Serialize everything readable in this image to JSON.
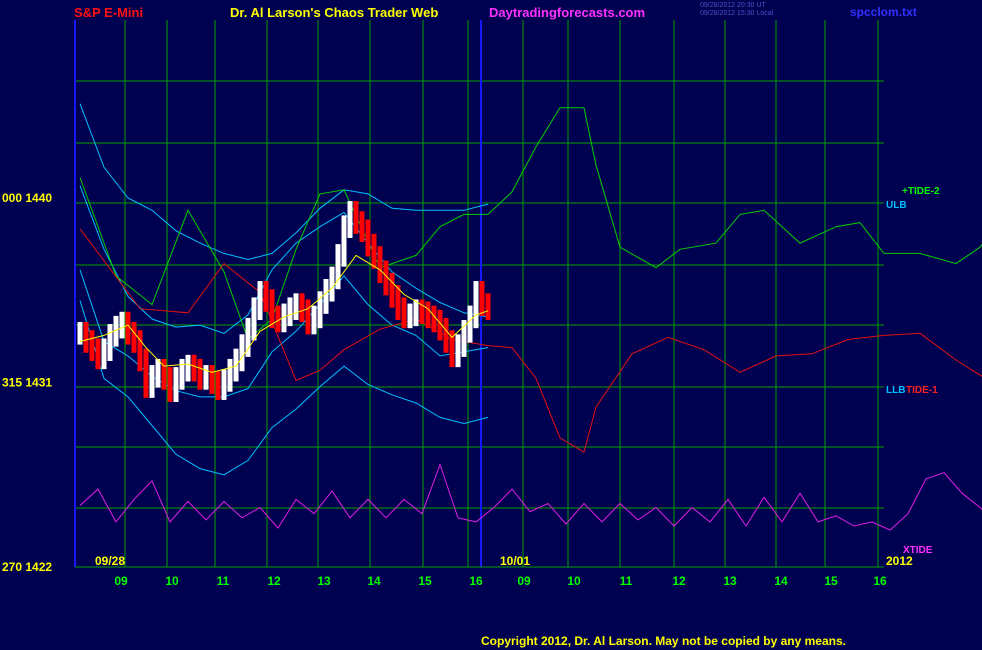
{
  "header": {
    "symbol": "S&P E-Mini",
    "title": "Dr. Al Larson's Chaos Trader Web",
    "site": "Daytradingforecasts.com",
    "stamp_line1": "09/28/2012 20:30 UT",
    "stamp_line2": "09/28/2012 15:30 Local",
    "file": "spcclom.txt"
  },
  "footer": {
    "copyright": "Copyright 2012, Dr. Al Larson. May not be copied by any means."
  },
  "colors": {
    "background": "#000050",
    "grid": "#00a000",
    "price_up": "#ffffff",
    "price_down": "#ff0000",
    "average": "#ffff00",
    "band": "#00c0ff",
    "tide_plus2": "#00d000",
    "tide_minus1": "#e01010",
    "xtide": "#e020e0",
    "divider": "#1818ff"
  },
  "chart_data": {
    "type": "line",
    "left_axis_labels": [
      {
        "text": "000  1440",
        "price": 1440
      },
      {
        "text": "315  1431",
        "price": 1431
      },
      {
        "text": "270  1422",
        "price": 1422
      }
    ],
    "ylim": [
      1422,
      1440
    ],
    "date_labels": [
      "09/28",
      "10/01"
    ],
    "hour_ticks": [
      "09",
      "10",
      "11",
      "12",
      "13",
      "14",
      "15",
      "16",
      "09",
      "10",
      "11",
      "12",
      "13",
      "14",
      "15",
      "16"
    ],
    "year_label": "2012",
    "series_labels": [
      "+TIDE-2",
      "ULB",
      "LLB",
      "TIDE-1",
      "XTIDE"
    ],
    "price_bars": [
      [
        0,
        1433.4
      ],
      [
        1,
        1433.0
      ],
      [
        2,
        1432.6
      ],
      [
        3,
        1432.2
      ],
      [
        4,
        1432.6
      ],
      [
        5,
        1433.3
      ],
      [
        6,
        1433.7
      ],
      [
        7,
        1433.9
      ],
      [
        8,
        1433.4
      ],
      [
        9,
        1433.0
      ],
      [
        10,
        1432.1
      ],
      [
        11,
        1430.8
      ],
      [
        12,
        1431.3
      ],
      [
        13,
        1431.6
      ],
      [
        14,
        1431.2
      ],
      [
        15,
        1430.6
      ],
      [
        16,
        1431.2
      ],
      [
        17,
        1431.6
      ],
      [
        18,
        1431.8
      ],
      [
        19,
        1431.6
      ],
      [
        20,
        1431.2
      ],
      [
        21,
        1431.3
      ],
      [
        22,
        1431.0
      ],
      [
        23,
        1430.7
      ],
      [
        24,
        1431.1
      ],
      [
        25,
        1431.6
      ],
      [
        26,
        1432.1
      ],
      [
        27,
        1432.8
      ],
      [
        28,
        1433.6
      ],
      [
        29,
        1434.6
      ],
      [
        30,
        1435.4
      ],
      [
        31,
        1435.0
      ],
      [
        32,
        1434.2
      ],
      [
        33,
        1434.0
      ],
      [
        34,
        1434.3
      ],
      [
        35,
        1434.6
      ],
      [
        36,
        1434.8
      ],
      [
        37,
        1434.5
      ],
      [
        38,
        1433.9
      ],
      [
        39,
        1434.2
      ],
      [
        40,
        1434.9
      ],
      [
        41,
        1435.5
      ],
      [
        42,
        1436.1
      ],
      [
        43,
        1437.2
      ],
      [
        44,
        1438.6
      ],
      [
        45,
        1439.3
      ],
      [
        46,
        1438.8
      ],
      [
        47,
        1438.4
      ],
      [
        48,
        1437.7
      ],
      [
        49,
        1437.1
      ],
      [
        50,
        1436.4
      ],
      [
        51,
        1435.8
      ],
      [
        52,
        1435.2
      ],
      [
        53,
        1434.6
      ],
      [
        54,
        1434.2
      ],
      [
        55,
        1434.3
      ],
      [
        56,
        1434.5
      ],
      [
        57,
        1434.4
      ],
      [
        58,
        1434.2
      ],
      [
        59,
        1434.0
      ],
      [
        60,
        1433.6
      ],
      [
        61,
        1433.0
      ],
      [
        62,
        1432.3
      ],
      [
        63,
        1432.8
      ],
      [
        64,
        1433.5
      ],
      [
        65,
        1434.2
      ],
      [
        66,
        1435.4
      ],
      [
        67,
        1434.8
      ],
      [
        68,
        1434.6
      ]
    ],
    "price_x": {
      "start": 0,
      "end": 68
    },
    "average": [
      [
        0,
        1433.0
      ],
      [
        4,
        1433.3
      ],
      [
        8,
        1433.8
      ],
      [
        11,
        1432.7
      ],
      [
        14,
        1431.8
      ],
      [
        18,
        1431.9
      ],
      [
        22,
        1431.5
      ],
      [
        26,
        1431.8
      ],
      [
        30,
        1433.5
      ],
      [
        34,
        1434.2
      ],
      [
        38,
        1434.6
      ],
      [
        42,
        1435.6
      ],
      [
        46,
        1437.2
      ],
      [
        50,
        1436.5
      ],
      [
        54,
        1435.3
      ],
      [
        58,
        1434.6
      ],
      [
        62,
        1433.2
      ],
      [
        66,
        1434.3
      ],
      [
        68,
        1434.5
      ]
    ],
    "upper_band_1": [
      [
        0,
        1444.6
      ],
      [
        4,
        1441.5
      ],
      [
        8,
        1440.0
      ],
      [
        12,
        1439.4
      ],
      [
        16,
        1438.4
      ],
      [
        20,
        1437.8
      ],
      [
        24,
        1437.3
      ],
      [
        28,
        1437.0
      ],
      [
        32,
        1437.3
      ],
      [
        36,
        1438.3
      ],
      [
        40,
        1439.5
      ],
      [
        44,
        1440.4
      ],
      [
        48,
        1440.2
      ],
      [
        52,
        1439.5
      ],
      [
        56,
        1439.4
      ],
      [
        60,
        1439.4
      ],
      [
        64,
        1439.4
      ],
      [
        68,
        1439.7
      ]
    ],
    "upper_band_2": [
      [
        0,
        1440.6
      ],
      [
        4,
        1437.5
      ],
      [
        8,
        1435.2
      ],
      [
        12,
        1434.1
      ],
      [
        16,
        1433.7
      ],
      [
        20,
        1433.8
      ],
      [
        24,
        1433.4
      ],
      [
        28,
        1434.3
      ],
      [
        32,
        1436.5
      ],
      [
        36,
        1437.8
      ],
      [
        40,
        1438.6
      ],
      [
        44,
        1439.3
      ],
      [
        48,
        1437.8
      ],
      [
        52,
        1436.4
      ],
      [
        56,
        1435.6
      ],
      [
        60,
        1434.9
      ],
      [
        64,
        1434.4
      ],
      [
        68,
        1434.2
      ]
    ],
    "lower_band_1": [
      [
        0,
        1436.5
      ],
      [
        4,
        1433.0
      ],
      [
        8,
        1432.3
      ],
      [
        12,
        1431.3
      ],
      [
        16,
        1430.6
      ],
      [
        20,
        1430.3
      ],
      [
        24,
        1430.3
      ],
      [
        28,
        1430.7
      ],
      [
        32,
        1432.5
      ],
      [
        36,
        1433.5
      ],
      [
        40,
        1434.8
      ],
      [
        44,
        1436.2
      ],
      [
        48,
        1434.8
      ],
      [
        52,
        1433.8
      ],
      [
        56,
        1433.3
      ],
      [
        60,
        1432.3
      ],
      [
        64,
        1432.5
      ],
      [
        68,
        1432.7
      ]
    ],
    "lower_band_2": [
      [
        0,
        1435.0
      ],
      [
        4,
        1431.2
      ],
      [
        8,
        1430.3
      ],
      [
        12,
        1428.9
      ],
      [
        16,
        1427.5
      ],
      [
        20,
        1426.8
      ],
      [
        24,
        1426.5
      ],
      [
        28,
        1427.2
      ],
      [
        32,
        1428.8
      ],
      [
        36,
        1429.7
      ],
      [
        40,
        1430.8
      ],
      [
        44,
        1431.8
      ],
      [
        48,
        1430.9
      ],
      [
        52,
        1430.4
      ],
      [
        56,
        1430.0
      ],
      [
        60,
        1429.3
      ],
      [
        64,
        1429.0
      ],
      [
        68,
        1429.3
      ]
    ],
    "tide_plus2": [
      [
        0,
        1441.0
      ],
      [
        6,
        1436.2
      ],
      [
        12,
        1434.8
      ],
      [
        18,
        1439.4
      ],
      [
        24,
        1436.4
      ],
      [
        28,
        1433.1
      ],
      [
        32,
        1434.1
      ],
      [
        36,
        1437.5
      ],
      [
        40,
        1440.2
      ],
      [
        44,
        1440.4
      ],
      [
        50,
        1436.6
      ],
      [
        56,
        1437.2
      ],
      [
        60,
        1438.6
      ],
      [
        64,
        1439.2
      ],
      [
        68,
        1439.2
      ],
      [
        72,
        1440.3
      ],
      [
        76,
        1442.5
      ],
      [
        80,
        1444.4
      ],
      [
        84,
        1444.4
      ],
      [
        86,
        1441.6
      ],
      [
        90,
        1437.6
      ],
      [
        96,
        1436.6
      ],
      [
        100,
        1437.5
      ],
      [
        106,
        1437.8
      ],
      [
        110,
        1439.2
      ],
      [
        114,
        1439.4
      ],
      [
        120,
        1437.8
      ],
      [
        126,
        1438.6
      ],
      [
        130,
        1438.8
      ],
      [
        134,
        1437.3
      ],
      [
        140,
        1437.3
      ],
      [
        146,
        1436.8
      ],
      [
        150,
        1437.6
      ],
      [
        156,
        1440.0
      ],
      [
        160,
        1440.3
      ]
    ],
    "tide_minus1": [
      [
        0,
        1438.5
      ],
      [
        10,
        1434.6
      ],
      [
        18,
        1434.4
      ],
      [
        24,
        1436.8
      ],
      [
        30,
        1435.4
      ],
      [
        36,
        1431.1
      ],
      [
        40,
        1431.6
      ],
      [
        44,
        1432.6
      ],
      [
        50,
        1433.6
      ],
      [
        56,
        1434.1
      ],
      [
        62,
        1433.1
      ],
      [
        68,
        1432.8
      ],
      [
        72,
        1432.7
      ],
      [
        76,
        1431.2
      ],
      [
        80,
        1428.3
      ],
      [
        84,
        1427.6
      ],
      [
        86,
        1429.8
      ],
      [
        92,
        1432.4
      ],
      [
        98,
        1433.2
      ],
      [
        104,
        1432.6
      ],
      [
        110,
        1431.5
      ],
      [
        116,
        1432.3
      ],
      [
        122,
        1432.4
      ],
      [
        128,
        1433.1
      ],
      [
        134,
        1433.3
      ],
      [
        140,
        1433.4
      ],
      [
        146,
        1432.1
      ],
      [
        152,
        1431.0
      ],
      [
        156,
        1430.9
      ]
    ],
    "xtide": [
      [
        0,
        1425.0
      ],
      [
        3,
        1425.8
      ],
      [
        6,
        1424.2
      ],
      [
        9,
        1425.3
      ],
      [
        12,
        1426.2
      ],
      [
        15,
        1424.2
      ],
      [
        18,
        1425.2
      ],
      [
        21,
        1424.3
      ],
      [
        24,
        1425.2
      ],
      [
        27,
        1424.4
      ],
      [
        30,
        1424.9
      ],
      [
        33,
        1423.9
      ],
      [
        36,
        1425.3
      ],
      [
        39,
        1424.6
      ],
      [
        42,
        1425.7
      ],
      [
        45,
        1424.4
      ],
      [
        48,
        1425.3
      ],
      [
        51,
        1424.4
      ],
      [
        54,
        1425.3
      ],
      [
        57,
        1424.6
      ],
      [
        60,
        1427.0
      ],
      [
        63,
        1424.4
      ],
      [
        66,
        1424.2
      ],
      [
        69,
        1424.9
      ],
      [
        72,
        1425.8
      ],
      [
        75,
        1424.7
      ],
      [
        78,
        1425.1
      ],
      [
        81,
        1424.1
      ],
      [
        84,
        1425.1
      ],
      [
        87,
        1424.2
      ],
      [
        90,
        1425.1
      ],
      [
        93,
        1424.3
      ],
      [
        96,
        1424.9
      ],
      [
        99,
        1424.0
      ],
      [
        102,
        1424.9
      ],
      [
        105,
        1424.2
      ],
      [
        108,
        1425.3
      ],
      [
        111,
        1424.0
      ],
      [
        114,
        1425.4
      ],
      [
        117,
        1424.2
      ],
      [
        120,
        1425.6
      ],
      [
        123,
        1424.2
      ],
      [
        126,
        1424.5
      ],
      [
        129,
        1424.0
      ],
      [
        132,
        1424.2
      ],
      [
        135,
        1423.8
      ],
      [
        138,
        1424.6
      ],
      [
        141,
        1426.3
      ],
      [
        144,
        1426.6
      ],
      [
        147,
        1425.6
      ],
      [
        150,
        1424.9
      ],
      [
        153,
        1424.1
      ],
      [
        156,
        1422.7
      ]
    ]
  }
}
